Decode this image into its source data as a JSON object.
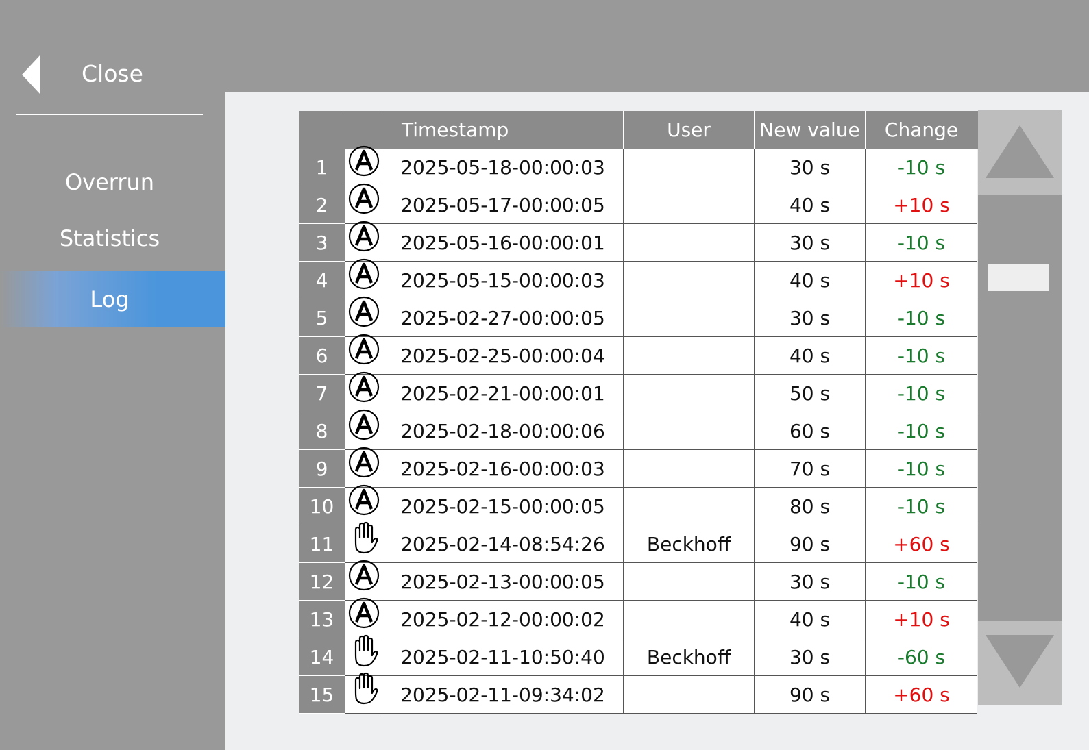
{
  "sidebar": {
    "close_label": "Close",
    "items": [
      {
        "label": "Overrun",
        "active": false
      },
      {
        "label": "Statistics",
        "active": false
      },
      {
        "label": "Log",
        "active": true
      }
    ]
  },
  "colors": {
    "negative_change": "#1a7a2e",
    "positive_change": "#e01010",
    "active_nav": "#4a95dc"
  },
  "table": {
    "headers": [
      "",
      "",
      "Timestamp",
      "User",
      "New value",
      "Change"
    ],
    "rows": [
      {
        "index": "1",
        "icon": "automatic-a-icon",
        "timestamp": "2025-05-18-00:00:03",
        "user": "",
        "new_value": "30 s",
        "change": "-10 s"
      },
      {
        "index": "2",
        "icon": "automatic-a-icon",
        "timestamp": "2025-05-17-00:00:05",
        "user": "",
        "new_value": "40 s",
        "change": "+10 s"
      },
      {
        "index": "3",
        "icon": "automatic-a-icon",
        "timestamp": "2025-05-16-00:00:01",
        "user": "",
        "new_value": "30 s",
        "change": "-10 s"
      },
      {
        "index": "4",
        "icon": "automatic-a-icon",
        "timestamp": "2025-05-15-00:00:03",
        "user": "",
        "new_value": "40 s",
        "change": "+10 s"
      },
      {
        "index": "5",
        "icon": "automatic-a-icon",
        "timestamp": "2025-02-27-00:00:05",
        "user": "",
        "new_value": "30 s",
        "change": "-10 s"
      },
      {
        "index": "6",
        "icon": "automatic-a-icon",
        "timestamp": "2025-02-25-00:00:04",
        "user": "",
        "new_value": "40 s",
        "change": "-10 s"
      },
      {
        "index": "7",
        "icon": "automatic-a-icon",
        "timestamp": "2025-02-21-00:00:01",
        "user": "",
        "new_value": "50 s",
        "change": "-10 s"
      },
      {
        "index": "8",
        "icon": "automatic-a-icon",
        "timestamp": "2025-02-18-00:00:06",
        "user": "",
        "new_value": "60 s",
        "change": "-10 s"
      },
      {
        "index": "9",
        "icon": "automatic-a-icon",
        "timestamp": "2025-02-16-00:00:03",
        "user": "",
        "new_value": "70 s",
        "change": "-10 s"
      },
      {
        "index": "10",
        "icon": "automatic-a-icon",
        "timestamp": "2025-02-15-00:00:05",
        "user": "",
        "new_value": "80 s",
        "change": "-10 s"
      },
      {
        "index": "11",
        "icon": "manual-hand-icon",
        "timestamp": "2025-02-14-08:54:26",
        "user": "Beckhoff",
        "new_value": "90 s",
        "change": "+60 s"
      },
      {
        "index": "12",
        "icon": "automatic-a-icon",
        "timestamp": "2025-02-13-00:00:05",
        "user": "",
        "new_value": "30 s",
        "change": "-10 s"
      },
      {
        "index": "13",
        "icon": "automatic-a-icon",
        "timestamp": "2025-02-12-00:00:02",
        "user": "",
        "new_value": "40 s",
        "change": "+10 s"
      },
      {
        "index": "14",
        "icon": "manual-hand-icon",
        "timestamp": "2025-02-11-10:50:40",
        "user": "Beckhoff",
        "new_value": "30 s",
        "change": "-60 s"
      },
      {
        "index": "15",
        "icon": "manual-hand-icon",
        "timestamp": "2025-02-11-09:34:02",
        "user": "",
        "new_value": "90 s",
        "change": "+60 s"
      }
    ]
  }
}
